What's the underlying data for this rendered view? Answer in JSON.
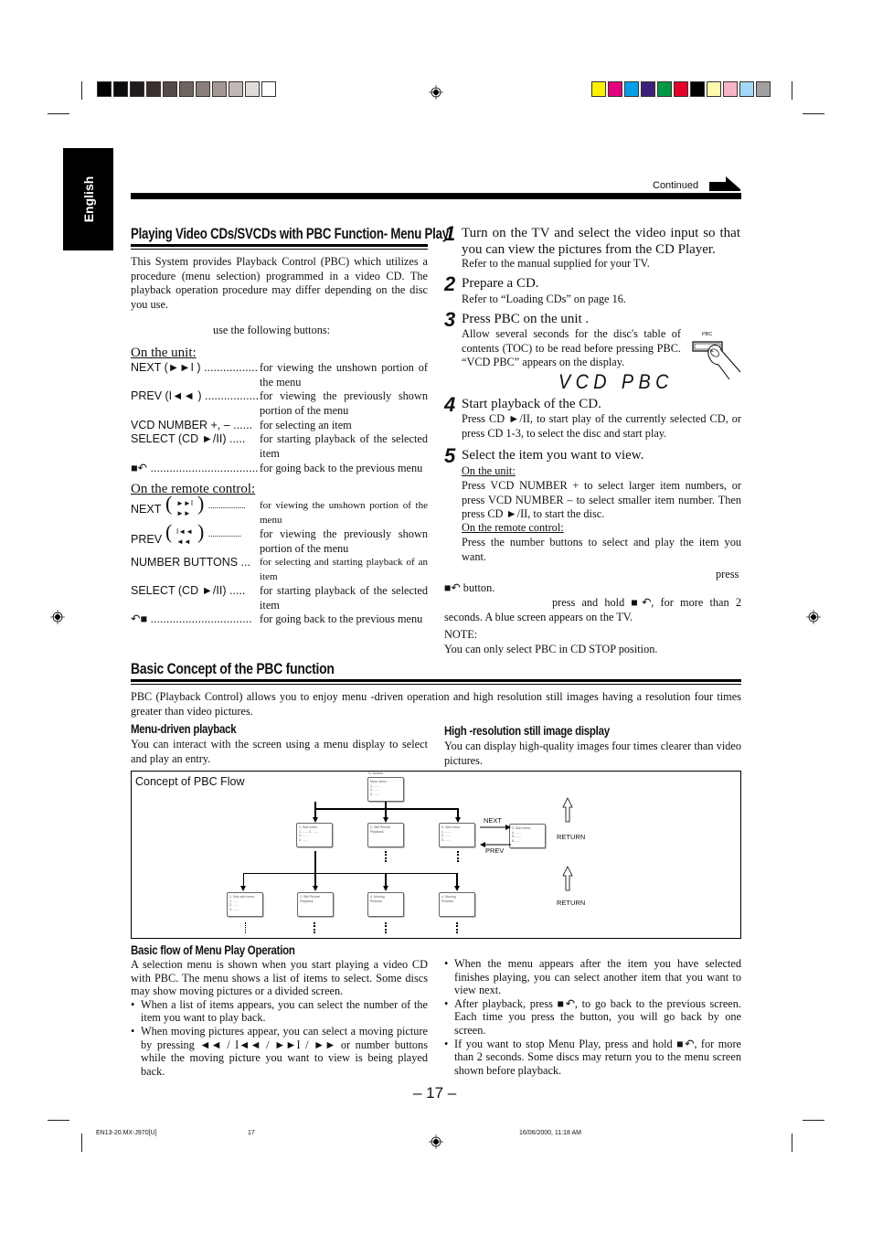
{
  "print_marks": {
    "grayscale_swatches": [
      "#000000",
      "#0c0c0c",
      "#201c1b",
      "#3a302d",
      "#544a47",
      "#6e6561",
      "#8a7f7b",
      "#a39894",
      "#c2b8b5",
      "#e0dcda",
      "#ffffff"
    ],
    "color_swatches": [
      "#fff200",
      "#e4007f",
      "#00a0e9",
      "#3e1f7a",
      "#009944",
      "#e60027",
      "#000000",
      "#fffbaa",
      "#f8b4c9",
      "#9fd9f6",
      "#a0a0a0"
    ]
  },
  "sidebar": {
    "language_tab": "English"
  },
  "header": {
    "continued_label": "Continued"
  },
  "left": {
    "title": "Playing Video CDs/SVCDs with PBC Function- Menu Play",
    "intro": "This System provides Playback Control (PBC) which utilizes a procedure (menu selection) programmed in a video CD. The playback operation procedure may differ depending on the disc you use.",
    "buttons_intro": "use the following buttons:",
    "unit": {
      "heading": "On the unit:",
      "rows": [
        {
          "key": "NEXT (►►I ) .................",
          "value": "for viewing the unshown portion of the menu"
        },
        {
          "key": "PREV (I◄◄ ) .................",
          "value": "for viewing the previously shown portion of the menu"
        },
        {
          "key": "VCD NUMBER +, – ......",
          "value": "for selecting an item"
        },
        {
          "key": "SELECT (CD ►/II) .....",
          "value": "for starting playback of the selected item"
        },
        {
          "key": "■↶ ..................................",
          "value": "for going back to the previous menu"
        }
      ]
    },
    "remote": {
      "heading": "On the remote control:",
      "rows": [
        {
          "key": "NEXT",
          "symbol_top": "►►I",
          "symbol_bottom": "►►",
          "dots": "..................",
          "value": "for viewing the unshown portion of the menu"
        },
        {
          "key": "PREV",
          "symbol_top": "I◄◄",
          "symbol_bottom": "◄◄",
          "dots": "................",
          "value": "for viewing the previously shown portion of the menu"
        },
        {
          "key": "NUMBER BUTTONS ...",
          "value": "for selecting and starting playback of an item"
        },
        {
          "key": "SELECT (CD ►/II) .....",
          "value": "for starting playback of the selected item"
        },
        {
          "key": "↶■ ................................",
          "value": "for going back to the previous menu"
        }
      ]
    }
  },
  "steps": [
    {
      "num": "1",
      "title": "Turn on the TV and select the video input so that you can view the pictures from the CD Player.",
      "body": "Refer to the manual supplied for your TV."
    },
    {
      "num": "2",
      "title": "Prepare a CD.",
      "body": "Refer to “Loading CDs” on page 16."
    },
    {
      "num": "3",
      "title": "Press PBC on the unit .",
      "body": "Allow several seconds for the disc's table of contents (TOC) to be read before pressing PBC. “VCD PBC” appears on the display.",
      "button_label": "PBC",
      "display_text": "VCD PBC"
    },
    {
      "num": "4",
      "title": "Start playback of the CD.",
      "body": "Press CD ►/II, to start play of the currently selected CD, or press CD 1-3, to select the disc and start play."
    },
    {
      "num": "5",
      "title": "Select the item you want to view.",
      "unit_heading": "On the unit:",
      "unit_body": "Press VCD NUMBER + to select larger item numbers, or press VCD NUMBER – to select smaller item number. Then press CD ►/II, to start the disc.",
      "remote_heading": "On the remote control:",
      "remote_body": "Press the number buttons to select and play the item you want."
    }
  ],
  "after_steps": {
    "press_line": "press",
    "button_line": "■↶ button.",
    "hold_line": "press and hold ■↶, for more than 2",
    "hold_line_2": "seconds. A blue screen appears on the TV.",
    "note_label": "NOTE:",
    "note_text": "You can only select PBC in CD STOP position."
  },
  "concept": {
    "title": "Basic Concept of the PBC function",
    "intro": "PBC (Playback Control) allows you to enjoy menu -driven operation and high resolution still images having a resolution four times greater than video pictures.",
    "menu_driven": {
      "heading": "Menu-driven playback",
      "text": "You can interact with the screen using a menu display to select and play an entry."
    },
    "high_res": {
      "heading": "High -resolution still image display",
      "text": "You can display high-quality images four times clearer than video pictures."
    }
  },
  "diagram": {
    "title": "Concept of PBC Flow",
    "tv_screen_label": "TV Screen",
    "main_menu": [
      "Main menu",
      "1. ......",
      "2. ......",
      "3. ......"
    ],
    "level1": [
      [
        "1. Sub menu",
        "1. ...... 4. ......",
        "2. ......",
        "3. ......"
      ],
      [
        "2. Still Picture",
        "Playback"
      ],
      [
        "3. Sub menu",
        "1. ......",
        "2. ......",
        "3. ......"
      ],
      [
        "3. Sub menu",
        "4. ......",
        "5. ......",
        "6. ......"
      ]
    ],
    "level2": [
      [
        "1. Sub-sub menu",
        "1. ......",
        "2. ......",
        "3. ......"
      ],
      [
        "2. Still Picture",
        "Playback"
      ],
      [
        "3. Moving",
        "Pictures"
      ],
      [
        "4. Moving",
        "Pictures"
      ]
    ],
    "next_label": "NEXT",
    "prev_label": "PREV",
    "return_label_1": "RETURN",
    "return_label_2": "RETURN"
  },
  "basic_flow": {
    "heading": "Basic flow of Menu Play Operation",
    "intro": "A selection menu is shown when you start playing a video CD with PBC. The menu shows a list of items to select. Some discs may show moving pictures or a divided screen.",
    "bullets_left": [
      "When a list of items appears, you can select the number of the item you want to play back.",
      "When moving pictures appear, you can select a moving picture by pressing ◄◄ / I◄◄ / ►►I / ►► or number buttons while the moving picture you want to view is being played back."
    ],
    "bullets_right": [
      "When the menu appears after the item you have selected finishes playing, you can select another item that you want to view next.",
      "After playback, press ■↶, to go back to the previous screen. Each time you press the button, you will go back by one screen.",
      "If you want to stop Menu Play, press and hold ■↶, for more than 2 seconds. Some discs may return you to the menu screen shown before playback."
    ]
  },
  "page_number": "– 17 –",
  "footer": {
    "file": "EN13-20.MX-J970[U]",
    "page": "17",
    "timestamp": "16/06/2000, 11:18 AM"
  }
}
